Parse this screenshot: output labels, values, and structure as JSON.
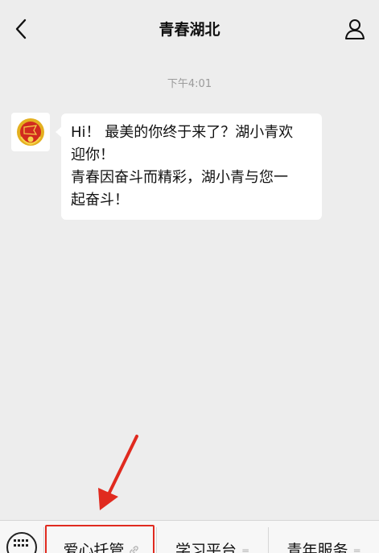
{
  "header": {
    "title": "青春湖北",
    "back_icon": "chevron-left-icon",
    "profile_icon": "person-icon"
  },
  "chat": {
    "timestamp": "下午4:01",
    "message_lines": [
      "Hi！ 最美的你终于来了？湖小青欢",
      "迎你！",
      "青春因奋斗而精彩，湖小青与您一",
      "起奋斗！"
    ]
  },
  "menu": {
    "items": [
      {
        "label": "爱心托管",
        "glyph": "🔗"
      },
      {
        "label": "学习平台",
        "glyph": "≡"
      },
      {
        "label": "青年服务",
        "glyph": "≡"
      }
    ]
  },
  "colors": {
    "background": "#ededed",
    "highlight": "#e02a1f",
    "bubble": "#ffffff"
  }
}
